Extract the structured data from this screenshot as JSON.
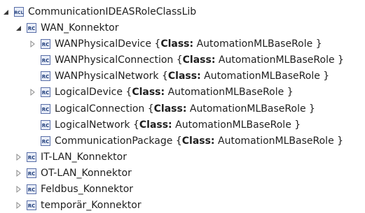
{
  "tree": {
    "root": {
      "label": "CommunicationIDEASRoleClassLib",
      "icon": "role-class-lib-icon",
      "icon_text": "RCL",
      "expanded": true
    },
    "wan": {
      "label": "WAN_Konnektor",
      "icon": "role-class-icon",
      "icon_text": "RC",
      "expanded": true
    },
    "class_prefix": "Class:",
    "items": [
      {
        "name": "WANPhysicalDevice",
        "class_value": "AutomationMLBaseRole }",
        "has_children": true
      },
      {
        "name": "WANPhysicalConnection",
        "class_value": "AutomationMLBaseRole }",
        "has_children": false
      },
      {
        "name": "WANPhysicalNetwork",
        "class_value": "AutomationMLBaseRole }",
        "has_children": false
      },
      {
        "name": "LogicalDevice",
        "class_value": "AutomationMLBaseRole }",
        "has_children": true
      },
      {
        "name": "LogicalConnection",
        "class_value": "AutomationMLBaseRole }",
        "has_children": false
      },
      {
        "name": "LogicalNetwork",
        "class_value": "AutomationMLBaseRole }",
        "has_children": false
      },
      {
        "name": "CommunicationPackage",
        "class_value": "AutomationMLBaseRole }",
        "has_children": false
      }
    ],
    "siblings": [
      {
        "label": "IT-LAN_Konnektor"
      },
      {
        "label": "OT-LAN_Konnektor"
      },
      {
        "label": "Feldbus_Konnektor"
      },
      {
        "label": "temporär_Konnektor"
      }
    ],
    "colors": {
      "text": "#1e1e1e",
      "icon_border": "#5a6fa8",
      "icon_bg": "#e9eef9",
      "icon_text": "#1f3d7a",
      "arrow_expanded": "#3a3a3a",
      "arrow_collapsed": "#8a8a8a"
    }
  }
}
